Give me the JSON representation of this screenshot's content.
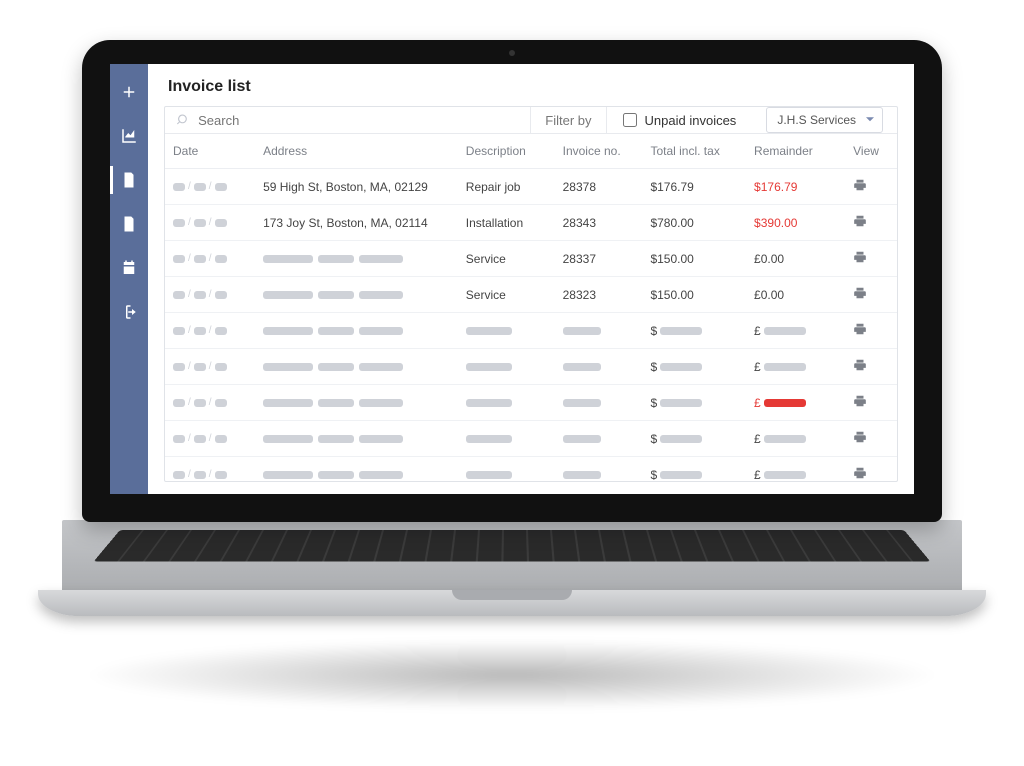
{
  "page": {
    "title": "Invoice list"
  },
  "filters": {
    "search_placeholder": "Search",
    "filter_by_label": "Filter by",
    "unpaid_label": "Unpaid invoices",
    "company_selected": "J.H.S Services"
  },
  "columns": {
    "date": "Date",
    "address": "Address",
    "description": "Description",
    "invoice_no": "Invoice no.",
    "total": "Total incl. tax",
    "remainder": "Remainder",
    "view": "View"
  },
  "rows": [
    {
      "address": "59 High St, Boston, MA, 02129",
      "description": "Repair job",
      "invoice_no": "28378",
      "total": "$176.79",
      "remainder": "$176.79",
      "remainder_red": true
    },
    {
      "address": "173 Joy St, Boston, MA, 02114",
      "description": "Installation",
      "invoice_no": "28343",
      "total": "$780.00",
      "remainder": "$390.00",
      "remainder_red": true
    },
    {
      "description": "Service",
      "invoice_no": "28337",
      "total": "$150.00",
      "remainder": "£0.00"
    },
    {
      "description": "Service",
      "invoice_no": "28323",
      "total": "$150.00",
      "remainder": "£0.00"
    },
    {
      "total_prefix": "$",
      "remainder_prefix": "£"
    },
    {
      "total_prefix": "$",
      "remainder_prefix": "£"
    },
    {
      "total_prefix": "$",
      "remainder_prefix": "£",
      "remainder_red": true
    },
    {
      "total_prefix": "$",
      "remainder_prefix": "£"
    },
    {
      "total_prefix": "$",
      "remainder_prefix": "£"
    }
  ]
}
